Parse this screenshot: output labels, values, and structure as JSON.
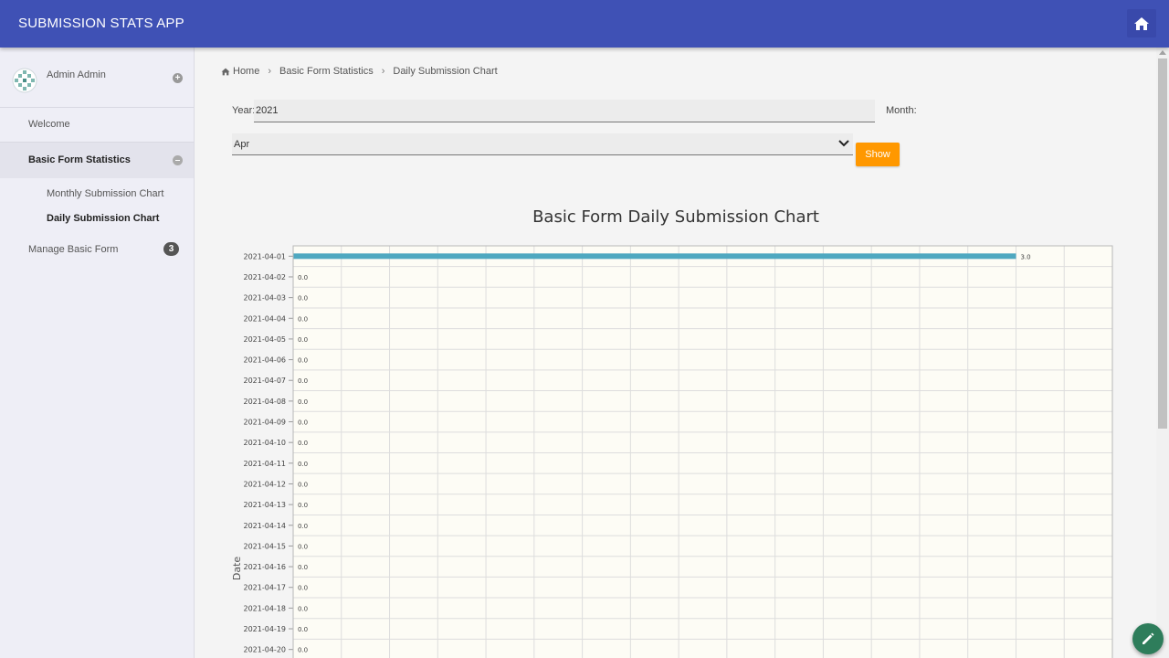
{
  "app": {
    "title": "SUBMISSION STATS APP"
  },
  "icons": {
    "home": "home-icon",
    "avatar": "avatar-icon",
    "edit": "pencil-icon",
    "expand": "plus-circle-icon",
    "collapse": "minus-circle-icon",
    "dropdown": "chevron-down-icon",
    "breadcrumb_sep": "chevron-right-icon"
  },
  "colors": {
    "topbar": "#3f51b5",
    "show_button": "#ff9800",
    "bar": "#4fa8c0",
    "fab": "#2e7d5b"
  },
  "sidebar": {
    "user_name": "Admin Admin",
    "items": [
      {
        "label": "Welcome"
      },
      {
        "label": "Basic Form Statistics"
      },
      {
        "label": "Monthly Submission Chart"
      },
      {
        "label": "Daily Submission Chart"
      },
      {
        "label": "Manage Basic Form",
        "badge": "3"
      }
    ]
  },
  "breadcrumb": [
    "Home",
    "Basic Form Statistics",
    "Daily Submission Chart"
  ],
  "form": {
    "year_label": "Year:",
    "year_value": "2021",
    "month_label": "Month:",
    "month_value": "Apr",
    "show_label": "Show"
  },
  "chart_data": {
    "type": "bar",
    "orientation": "horizontal",
    "title": "Basic Form Daily Submission Chart",
    "ylabel": "Date",
    "xlabel": "",
    "grid": true,
    "categories": [
      "2021-04-01",
      "2021-04-02",
      "2021-04-03",
      "2021-04-04",
      "2021-04-05",
      "2021-04-06",
      "2021-04-07",
      "2021-04-08",
      "2021-04-09",
      "2021-04-10",
      "2021-04-11",
      "2021-04-12",
      "2021-04-13",
      "2021-04-14",
      "2021-04-15",
      "2021-04-16",
      "2021-04-17",
      "2021-04-18",
      "2021-04-19",
      "2021-04-20"
    ],
    "values": [
      3.0,
      0.0,
      0.0,
      0.0,
      0.0,
      0.0,
      0.0,
      0.0,
      0.0,
      0.0,
      0.0,
      0.0,
      0.0,
      0.0,
      0.0,
      0.0,
      0.0,
      0.0,
      0.0,
      0.0
    ],
    "value_labels": [
      "3.0",
      "0.0",
      "0.0",
      "0.0",
      "0.0",
      "0.0",
      "0.0",
      "0.0",
      "0.0",
      "0.0",
      "0.0",
      "0.0",
      "0.0",
      "0.0",
      "0.0",
      "0.0",
      "0.0",
      "0.0",
      "0.0",
      "0.0"
    ],
    "xlim": [
      0,
      3.4
    ]
  }
}
